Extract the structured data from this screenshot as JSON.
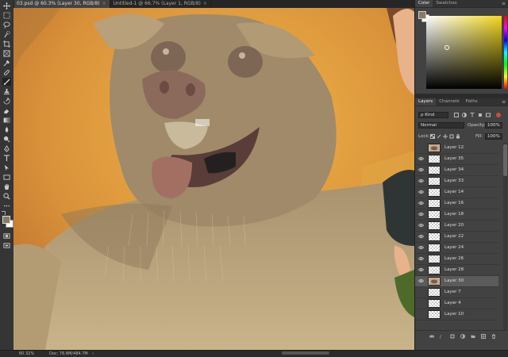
{
  "tabs": [
    {
      "label": "03.psd @ 60.3% (Layer 30, RGB/8)",
      "active": true
    },
    {
      "label": "Untitled-1 @ 66.7% (Layer 1, RGB/8)",
      "active": false
    }
  ],
  "tab_close": "×",
  "status": {
    "zoom": "60.32%",
    "doc": "Doc: 76.8M/484.7M",
    "arrow": "›"
  },
  "color_panel": {
    "tabs": [
      "Color",
      "Swatches"
    ],
    "menu": "≡",
    "hue_color": "#f2d81a"
  },
  "layers_panel": {
    "tabs": [
      "Layers",
      "Channels",
      "Paths"
    ],
    "menu": "≡",
    "filter_kind": "ρ Kind",
    "blend_mode": "Normal",
    "opacity_label": "Opacity:",
    "opacity_value": "100%",
    "lock_label": "Lock:",
    "fill_label": "Fill:",
    "fill_value": "100%",
    "layers": [
      {
        "name": "Layer 12",
        "visible": false,
        "selected": false,
        "thumb": "art"
      },
      {
        "name": "Layer 35",
        "visible": true,
        "selected": false,
        "thumb": "blank"
      },
      {
        "name": "Layer 34",
        "visible": true,
        "selected": false,
        "thumb": "blank"
      },
      {
        "name": "Layer 33",
        "visible": true,
        "selected": false,
        "thumb": "blank"
      },
      {
        "name": "Layer 14",
        "visible": true,
        "selected": false,
        "thumb": "blank"
      },
      {
        "name": "Layer 16",
        "visible": true,
        "selected": false,
        "thumb": "blank"
      },
      {
        "name": "Layer 18",
        "visible": true,
        "selected": false,
        "thumb": "blank"
      },
      {
        "name": "Layer 20",
        "visible": true,
        "selected": false,
        "thumb": "blank"
      },
      {
        "name": "Layer 22",
        "visible": true,
        "selected": false,
        "thumb": "blank"
      },
      {
        "name": "Layer 24",
        "visible": true,
        "selected": false,
        "thumb": "blank"
      },
      {
        "name": "Layer 26",
        "visible": true,
        "selected": false,
        "thumb": "blank"
      },
      {
        "name": "Layer 28",
        "visible": true,
        "selected": false,
        "thumb": "blank"
      },
      {
        "name": "Layer 30",
        "visible": true,
        "selected": true,
        "thumb": "art"
      },
      {
        "name": "Layer 7",
        "visible": false,
        "selected": false,
        "thumb": "blank"
      },
      {
        "name": "Layer 4",
        "visible": false,
        "selected": false,
        "thumb": "blank"
      },
      {
        "name": "Layer 10",
        "visible": false,
        "selected": false,
        "thumb": "blank"
      }
    ]
  },
  "colors": {
    "background": "#d08a38",
    "foreground_swatch": "#8a7a63",
    "background_swatch": "#ffffff"
  }
}
